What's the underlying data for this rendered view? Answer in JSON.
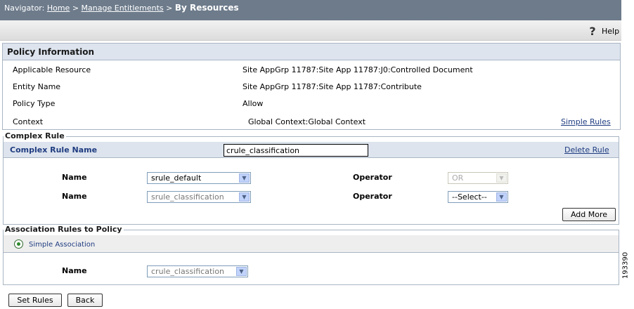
{
  "navigator": {
    "prefix": "Navigator:",
    "home": "Home",
    "sep1": ">",
    "manage": "Manage Entitlements",
    "sep2": ">",
    "current": "By Resources"
  },
  "toolbar": {
    "help": "Help"
  },
  "policy_info": {
    "title": "Policy Information",
    "rows": [
      {
        "label": "Applicable Resource",
        "value": "Site AppGrp 11787:Site App 11787:J0:Controlled Document"
      },
      {
        "label": "Entity Name",
        "value": "Site AppGrp 11787:Site App 11787:Contribute"
      },
      {
        "label": "Policy Type",
        "value": "Allow"
      },
      {
        "label": "Context",
        "value": "Global Context:Global Context"
      }
    ],
    "simple_rules_link": "Simple Rules"
  },
  "complex_rule": {
    "legend": "Complex Rule",
    "name_label": "Complex Rule Name",
    "name_value": "crule_classification",
    "delete_link": "Delete Rule",
    "rows": [
      {
        "name_label": "Name",
        "name_value": "srule_default",
        "operator_label": "Operator",
        "operator_value": "OR"
      },
      {
        "name_label": "Name",
        "name_value": "srule_classification",
        "operator_label": "Operator",
        "operator_value": "--Select--"
      }
    ],
    "add_more": "Add More"
  },
  "association": {
    "legend": "Association Rules to Policy",
    "option": "Simple Association",
    "name_label": "Name",
    "name_value": "crule_classification"
  },
  "buttons": {
    "set_rules": "Set Rules",
    "back": "Back"
  },
  "figure_id": "193390"
}
